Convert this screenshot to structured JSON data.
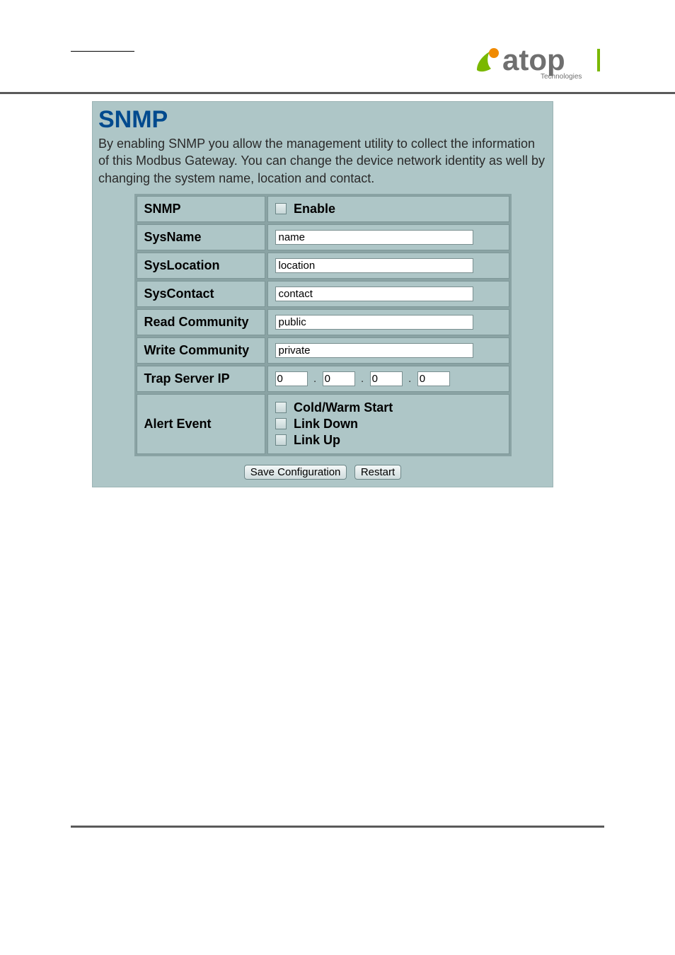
{
  "logo": {
    "brand": "atop",
    "sub": "Technologies"
  },
  "title": "SNMP",
  "description": "By enabling SNMP you allow the management utility to collect the information of this Modbus Gateway. You can change the device network identity as well by changing the system name, location and contact.",
  "rows": {
    "snmp": {
      "label": "SNMP",
      "enable_label": "Enable",
      "enable_checked": false
    },
    "sysname": {
      "label": "SysName",
      "value": "name"
    },
    "sysloc": {
      "label": "SysLocation",
      "value": "location"
    },
    "syscontact": {
      "label": "SysContact",
      "value": "contact"
    },
    "readcomm": {
      "label": "Read Community",
      "value": "public"
    },
    "writecomm": {
      "label": "Write Community",
      "value": "private"
    },
    "trapip": {
      "label": "Trap Server IP",
      "octets": [
        "0",
        "0",
        "0",
        "0"
      ]
    },
    "alert": {
      "label": "Alert Event",
      "items": [
        {
          "label": "Cold/Warm Start",
          "checked": false
        },
        {
          "label": "Link Down",
          "checked": false
        },
        {
          "label": "Link Up",
          "checked": false
        }
      ]
    }
  },
  "buttons": {
    "save": "Save  Configuration",
    "restart": "Restart"
  }
}
